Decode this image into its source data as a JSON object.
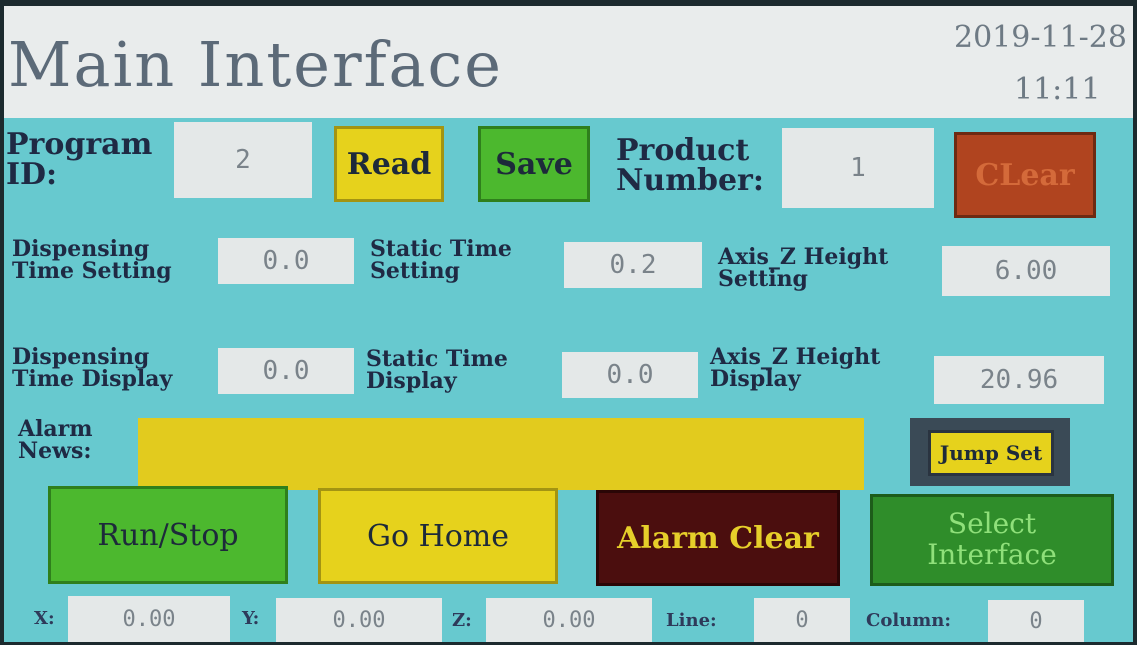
{
  "header": {
    "title": "Main Interface",
    "date": "2019-11-28",
    "time": "11:11"
  },
  "program": {
    "id_label_1": "Program",
    "id_label_2": "ID:",
    "id_value": "2",
    "read_label": "Read",
    "save_label": "Save",
    "product_label_1": "Product",
    "product_label_2": "Number:",
    "product_value": "1",
    "clear_label": "CLear"
  },
  "settings": {
    "dispensing_label_1": "Dispensing",
    "dispensing_label_2": "Time Setting",
    "dispensing_value": "0.0",
    "static_label_1": "Static Time",
    "static_label_2": "Setting",
    "static_value": "0.2",
    "axisz_label_1": "Axis_Z Height",
    "axisz_label_2": "Setting",
    "axisz_value": "6.00"
  },
  "display": {
    "dispensing_label_1": "Dispensing",
    "dispensing_label_2": "Time Display",
    "dispensing_value": "0.0",
    "static_label_1": "Static Time",
    "static_label_2": "Display",
    "static_value": "0.0",
    "axisz_label_1": "Axis_Z Height",
    "axisz_label_2": "Display",
    "axisz_value": "20.96"
  },
  "alarm": {
    "label_1": "Alarm",
    "label_2": "News:",
    "text": "",
    "jump_label": "Jump Set"
  },
  "actions": {
    "run_stop": "Run/Stop",
    "go_home": "Go Home",
    "alarm_clear": "Alarm Clear",
    "select_1": "Select",
    "select_2": "Interface"
  },
  "status": {
    "x_label": "X:",
    "x_value": "0.00",
    "y_label": "Y:",
    "y_value": "0.00",
    "z_label": "Z:",
    "z_value": "0.00",
    "line_label": "Line:",
    "line_value": "0",
    "column_label": "Column:",
    "column_value": "0"
  }
}
